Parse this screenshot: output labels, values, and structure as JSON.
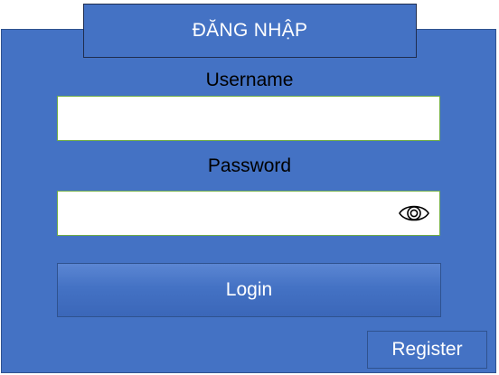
{
  "form": {
    "title": "ĐĂNG NHẬP",
    "username_label": "Username",
    "username_value": "",
    "password_label": "Password",
    "password_value": "",
    "toggle_icon": "eye-icon",
    "login_label": "Login",
    "register_label": "Register"
  },
  "colors": {
    "panel": "#4472c4",
    "panel_border": "#2f528f",
    "input_border": "#70ad47",
    "text_on_panel": "#ffffff",
    "label_text": "#000000"
  }
}
